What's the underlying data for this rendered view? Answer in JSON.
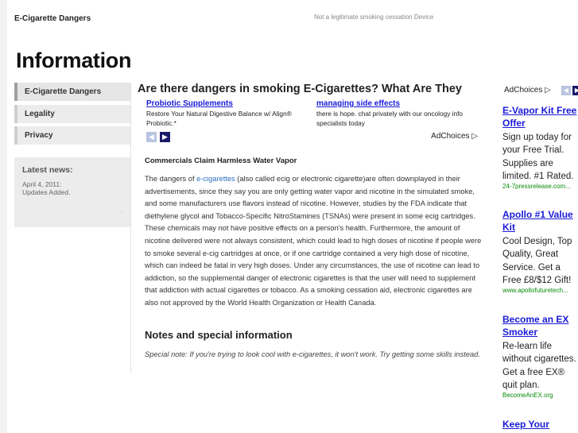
{
  "site": {
    "title": "E-Cigarette Dangers",
    "tagline": "Not a legitimate smoking cessation Device"
  },
  "page_title": "Information",
  "nav": {
    "items": [
      {
        "label": "E-Cigarette Dangers"
      },
      {
        "label": "Legality"
      },
      {
        "label": "Privacy"
      }
    ]
  },
  "news": {
    "title": "Latest news:",
    "date": "April 4, 2011:",
    "text": "Updates Added.",
    "dot": "."
  },
  "main": {
    "heading": "Are there dangers in smoking E-Cigarettes? What Are They",
    "ads": [
      {
        "link": "Probiotic Supplements",
        "desc": "Restore Your Natural Digestive Balance w/ Align® Probiotic.*"
      },
      {
        "link": "managing side effects",
        "desc": "there is hope. chat privately with our oncology info specialists today"
      }
    ],
    "ad_choices": "AdChoices ▷",
    "prev_arrow": "◀",
    "next_arrow": "▶",
    "section_heading": "Commercials Claim Harmless Water Vapor",
    "body_pre": "The dangers of ",
    "body_link": "e-cigarettes",
    "body_post": " (also called ecig or electronic cigarette)are often downplayed in their advertisements, since they say you are only getting water vapor and nicotine in the simulated smoke, and some manufacturers use flavors instead of nicotine. However, studies by the FDA indicate that diethylene glycol and Tobacco-Specific NitroStamines (TSNAs) were present in some ecig cartridges. These chemicals may not have positive effects on a person's health. Furthermore, the amount of nicotine delivered were not always consistent, which could lead to high doses of nicotine if people were to smoke several e-cig cartridges at once, or if one cartridge contained a very high dose of nicotine, which can indeed be fatal in very high doses. Under any circumstances, the use of nicotine can lead to addiction, so the supplemental danger of electronic cigarettes is that the user will need to supplement that addiction with actual cigarettes or tobacco. As a smoking cessation aid, electronic cigarettes are also not approved by the World Health Organization or Health Canada.",
    "notes_heading": "Notes and special information",
    "special_note": "Special note: If you're trying to look cool with e-cigarettes, it won't work. Try getting some skills instead."
  },
  "right_ads": {
    "ad_choices": "AdChoices ▷",
    "prev_arrow": "◀",
    "next_arrow": "▶",
    "items": [
      {
        "title": "E-Vapor Kit Free Offer",
        "desc": "Sign up today for your Free Trial. Supplies are limited. #1 Rated.",
        "url": "24-7pressrelease.com..."
      },
      {
        "title": "Apollo #1 Value Kit",
        "desc": "Cool Design, Top Quality, Great Service. Get a Free £8/$12 Gift!",
        "url": "www.apollofuturetech..."
      },
      {
        "title": "Become an EX Smoker",
        "desc": "Re-learn life without cigarettes. Get a free EX® quit plan.",
        "url": "BecomeAnEX.org"
      },
      {
        "title": "Keep Your",
        "desc": "",
        "url": ""
      }
    ]
  },
  "colors": {
    "link_blue": "#1a1ad8",
    "body_link": "#2a6fc1",
    "ad_url_green": "#0a8a0a",
    "nav_bg": "#ececec"
  }
}
